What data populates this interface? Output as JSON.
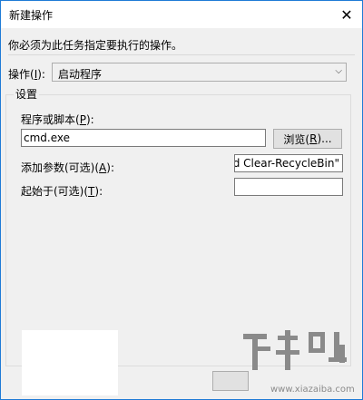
{
  "window": {
    "title": "新建操作"
  },
  "instruction": "你必须为此任务指定要执行的操作。",
  "action": {
    "label": "操作(",
    "key": "I",
    "suffix": "):",
    "value": "启动程序"
  },
  "settings": {
    "group_label": "设置",
    "program": {
      "label": "程序或脚本(",
      "key": "P",
      "suffix": "):",
      "value": "cmd.exe"
    },
    "browse": {
      "label": "浏览(",
      "key": "R",
      "suffix": ")..."
    },
    "args": {
      "label": "添加参数(可选)(",
      "key": "A",
      "suffix": "):",
      "value": "and Clear-RecycleBin\""
    },
    "start_in": {
      "label": "起始于(可选)(",
      "key": "T",
      "suffix": "):",
      "value": ""
    }
  },
  "watermark": {
    "text": "下载吧",
    "url": "www.xiazaiba.com"
  },
  "colors": {
    "border": "#1f7bd6",
    "panel": "#f0f0f0",
    "watermark": "#8a8a8a"
  }
}
